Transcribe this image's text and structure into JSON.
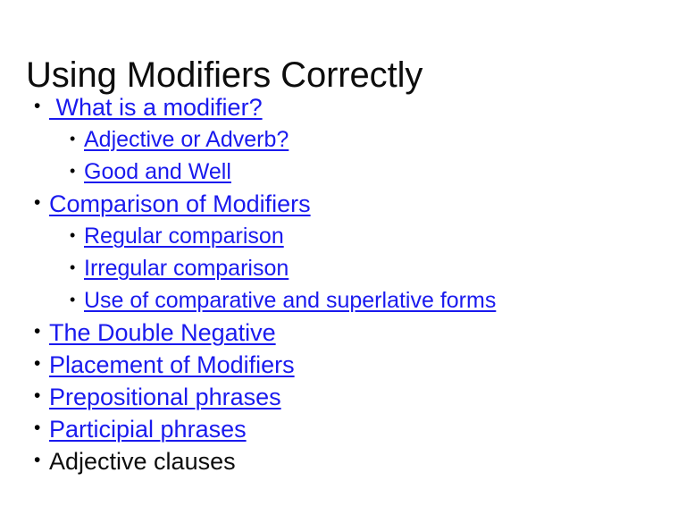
{
  "slide": {
    "title": "Using Modifiers Correctly",
    "background_color": "#FFFFFF",
    "title_color": "#0D0D0D",
    "link_color": "#1A1AEE",
    "text_color": "#0D0D0D",
    "bullet_glyph": "•",
    "items": [
      {
        "level": 1,
        "label": " What is a modifier?",
        "is_link": true
      },
      {
        "level": 2,
        "label": "Adjective or Adverb?",
        "is_link": true
      },
      {
        "level": 2,
        "label": "Good and Well",
        "is_link": true
      },
      {
        "level": 1,
        "label": "Comparison of Modifiers",
        "is_link": true
      },
      {
        "level": 2,
        "label": "Regular comparison",
        "is_link": true
      },
      {
        "level": 2,
        "label": "Irregular comparison",
        "is_link": true
      },
      {
        "level": 2,
        "label": "Use of comparative and superlative forms",
        "is_link": true
      },
      {
        "level": 1,
        "label": "The Double Negative",
        "is_link": true
      },
      {
        "level": 1,
        "label": "Placement of Modifiers",
        "is_link": true
      },
      {
        "level": 1,
        "label": "Prepositional phrases",
        "is_link": true
      },
      {
        "level": 1,
        "label": "Participial phrases",
        "is_link": true
      },
      {
        "level": 1,
        "label": "Adjective clauses",
        "is_link": false
      }
    ]
  }
}
